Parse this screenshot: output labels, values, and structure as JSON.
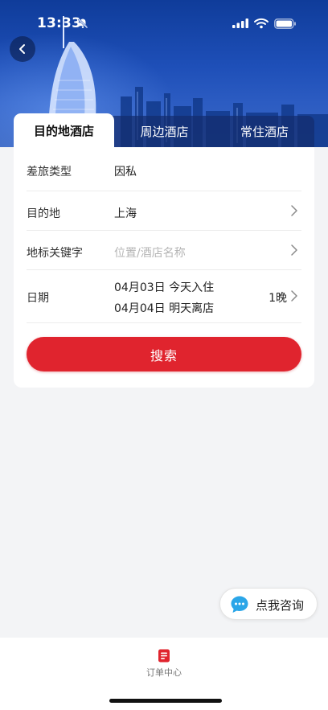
{
  "status_bar": {
    "time": "13:33",
    "icons": [
      "bell-slash-icon",
      "signal-icon",
      "wifi-icon",
      "battery-icon"
    ]
  },
  "header": {
    "back_icon": "chevron-left-icon",
    "banner": "hotel-skyline-banner"
  },
  "tabs": [
    {
      "label": "目的地酒店",
      "active": true
    },
    {
      "label": "周边酒店",
      "active": false
    },
    {
      "label": "常住酒店",
      "active": false
    }
  ],
  "form": {
    "travel_type": {
      "label": "差旅类型",
      "value": "因私"
    },
    "destination": {
      "label": "目的地",
      "value": "上海"
    },
    "landmark": {
      "label": "地标关键字",
      "placeholder": "位置/酒店名称"
    },
    "date": {
      "label": "日期",
      "checkin": "04月03日 今天入住",
      "checkout": "04月04日 明天离店",
      "nights": "1晚"
    },
    "search_label": "搜索"
  },
  "consult": {
    "label": "点我咨询",
    "icon": "chat-bubble-icon"
  },
  "bottom_nav": {
    "order_center_label": "订单中心",
    "icon": "order-list-icon"
  },
  "colors": {
    "accent": "#e0242e",
    "banner_blue": "#1e4fb8",
    "consult_blue": "#2ba6e8"
  }
}
